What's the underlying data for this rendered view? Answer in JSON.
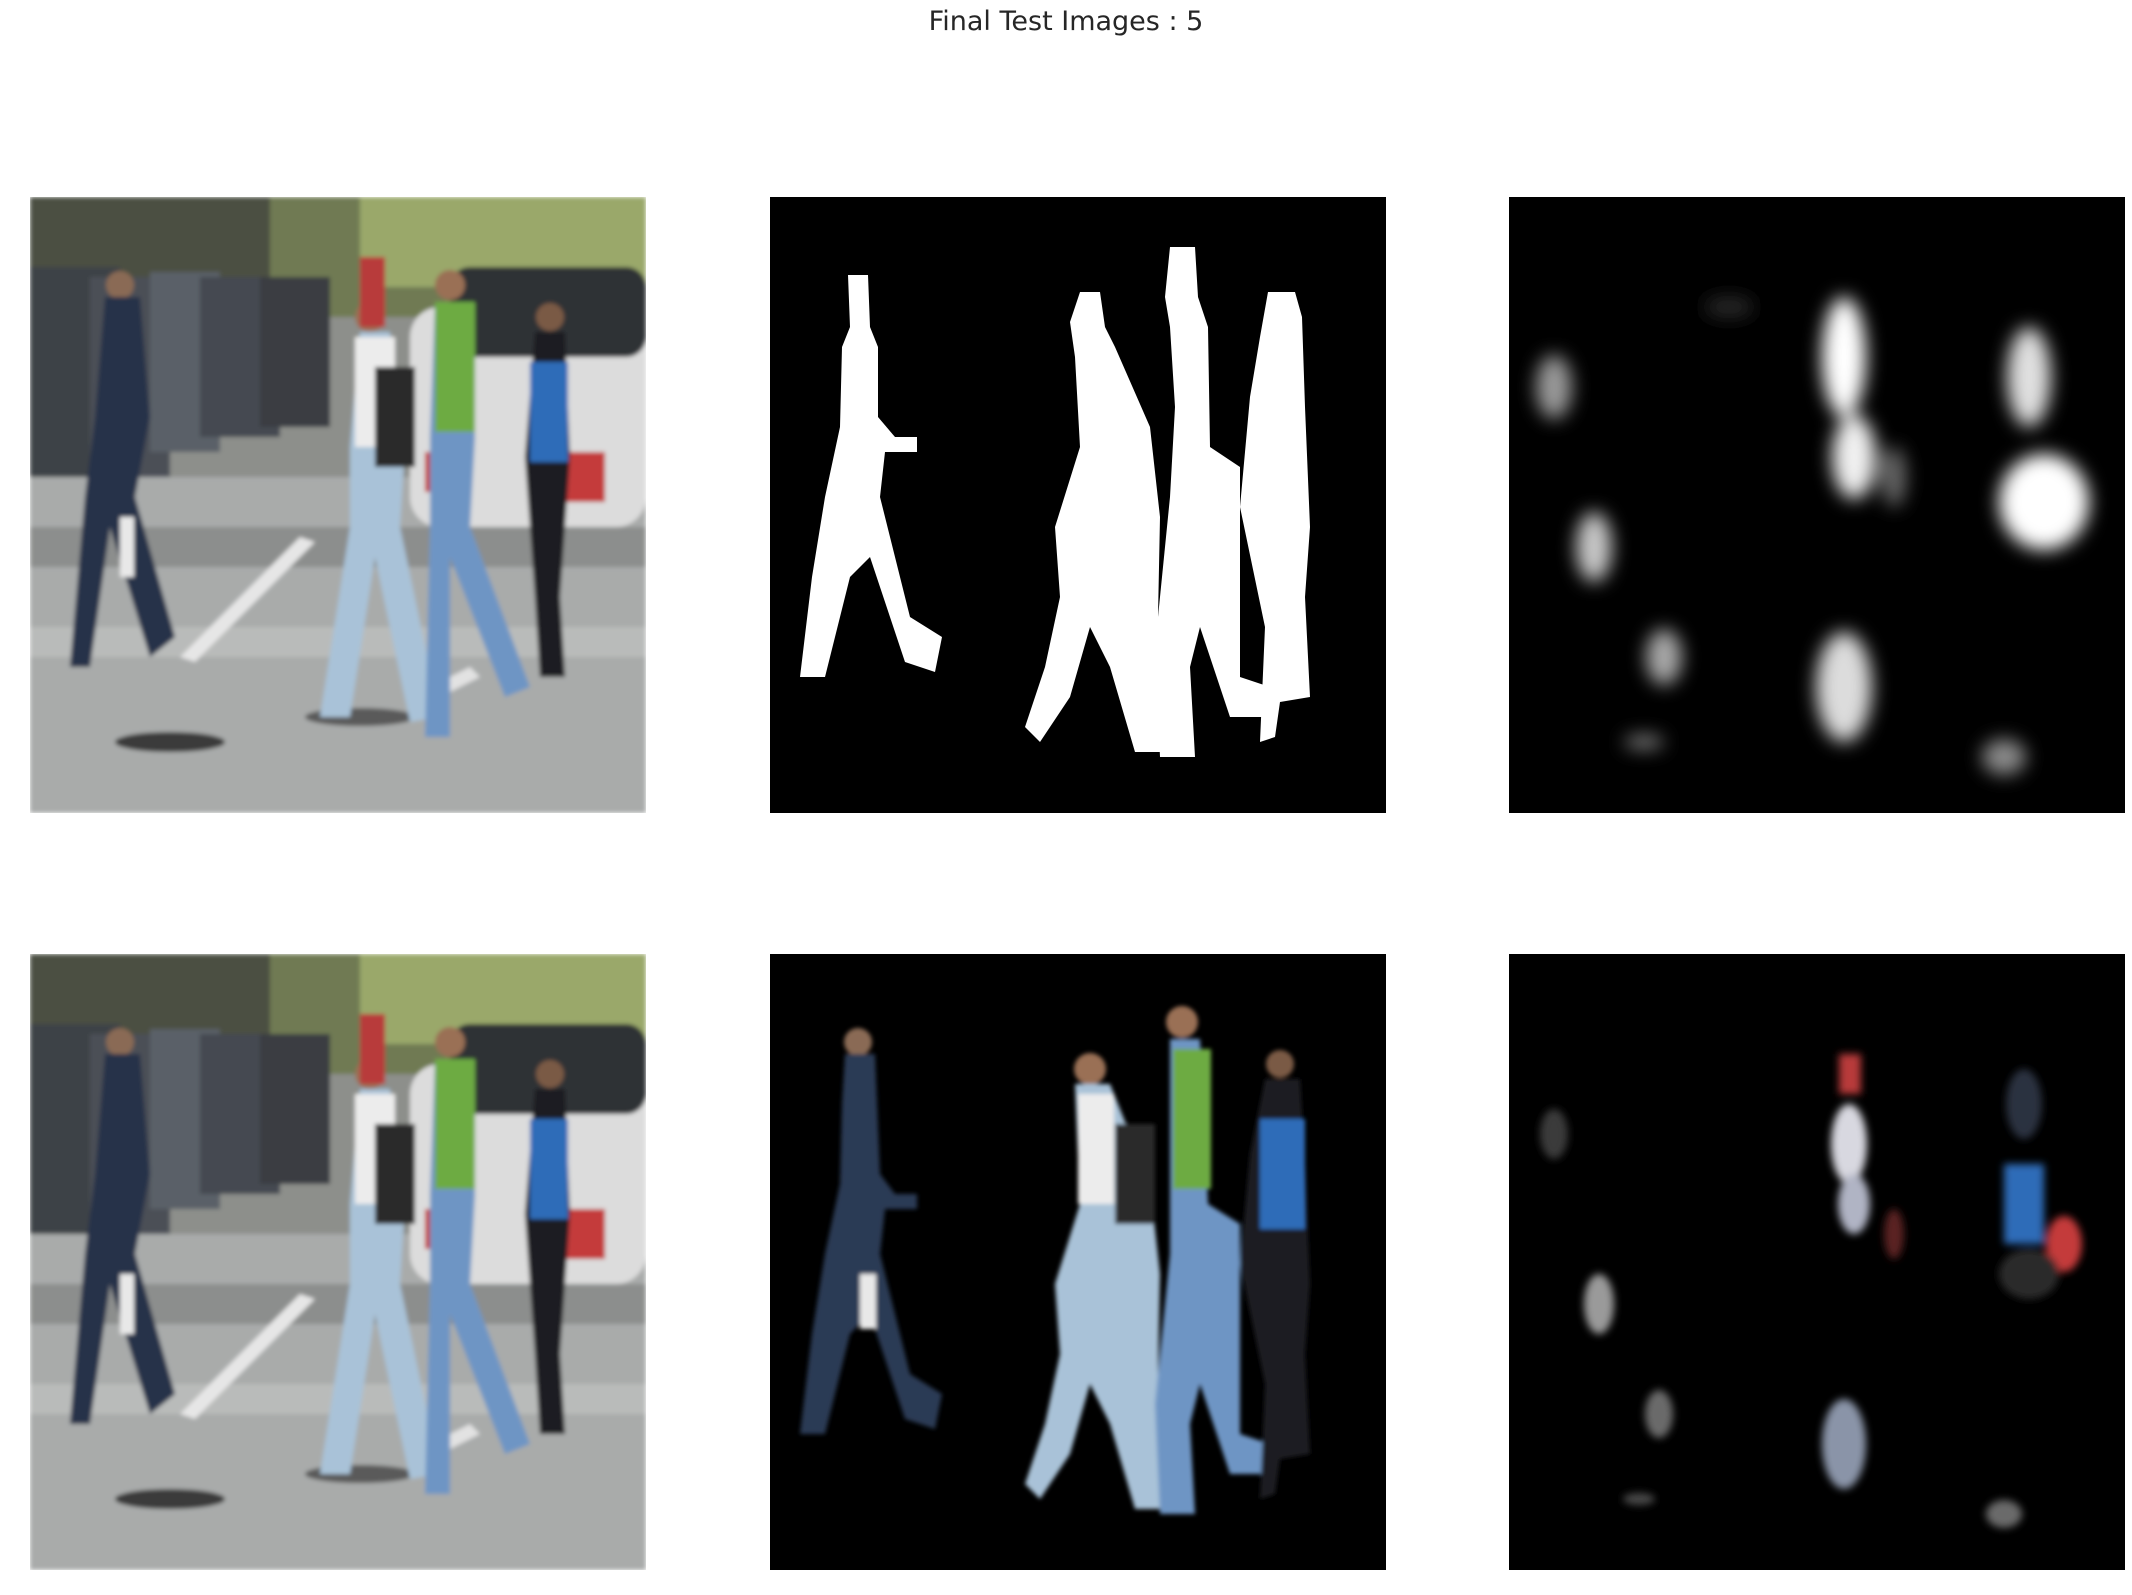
{
  "figure": {
    "title": "Final Test Images : 5"
  },
  "panels": [
    {
      "name": "input-image"
    },
    {
      "name": "ground-truth-mask"
    },
    {
      "name": "predicted-mask"
    },
    {
      "name": "input-image-copy"
    },
    {
      "name": "ground-truth-masked-image"
    },
    {
      "name": "predicted-masked-image"
    }
  ]
}
